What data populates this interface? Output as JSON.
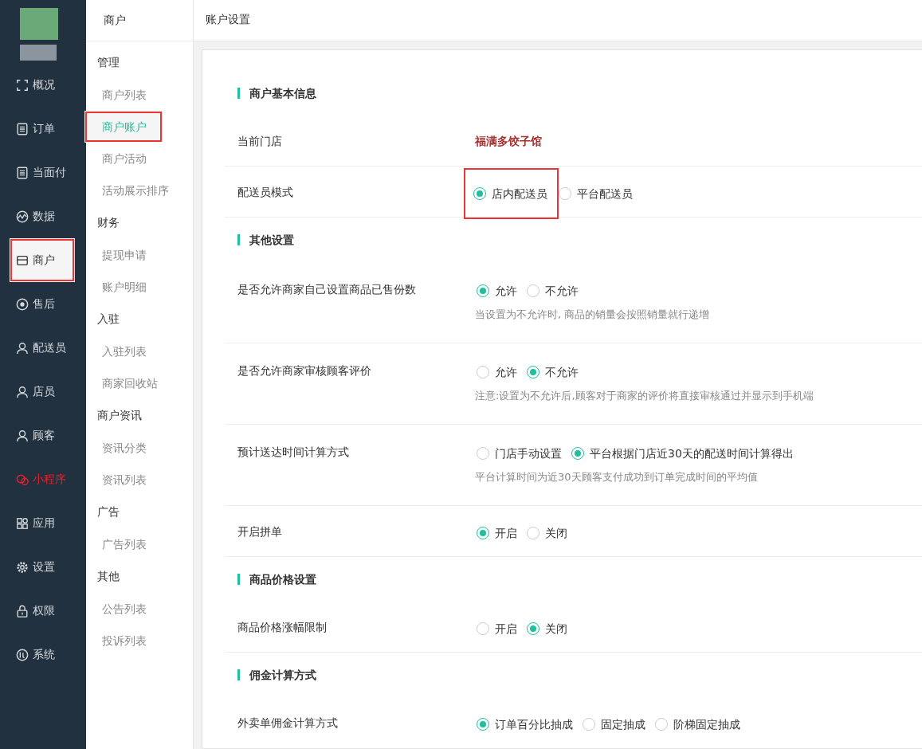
{
  "nav": [
    {
      "label": "概况",
      "selected": false,
      "alert": false,
      "marked": false
    },
    {
      "label": "订单",
      "selected": false,
      "alert": false,
      "marked": false
    },
    {
      "label": "当面付",
      "selected": false,
      "alert": false,
      "marked": false
    },
    {
      "label": "数据",
      "selected": false,
      "alert": false,
      "marked": false
    },
    {
      "label": "商户",
      "selected": true,
      "alert": false,
      "marked": true
    },
    {
      "label": "售后",
      "selected": false,
      "alert": false,
      "marked": false
    },
    {
      "label": "配送员",
      "selected": false,
      "alert": false,
      "marked": false
    },
    {
      "label": "店员",
      "selected": false,
      "alert": false,
      "marked": false
    },
    {
      "label": "顾客",
      "selected": false,
      "alert": false,
      "marked": false
    },
    {
      "label": "小程序",
      "selected": false,
      "alert": true,
      "marked": false
    },
    {
      "label": "应用",
      "selected": false,
      "alert": false,
      "marked": false
    },
    {
      "label": "设置",
      "selected": false,
      "alert": false,
      "marked": false
    },
    {
      "label": "权限",
      "selected": false,
      "alert": false,
      "marked": false
    },
    {
      "label": "系统",
      "selected": false,
      "alert": false,
      "marked": false
    }
  ],
  "subnav": {
    "title": "商户",
    "groups": [
      {
        "title": "管理",
        "items": [
          {
            "label": "商户列表",
            "selected": false,
            "marked": false
          },
          {
            "label": "商户账户",
            "selected": true,
            "marked": true
          },
          {
            "label": "商户活动",
            "selected": false,
            "marked": false
          },
          {
            "label": "活动展示排序",
            "selected": false,
            "marked": false
          }
        ]
      },
      {
        "title": "财务",
        "items": [
          {
            "label": "提现申请",
            "selected": false,
            "marked": false
          },
          {
            "label": "账户明细",
            "selected": false,
            "marked": false
          }
        ]
      },
      {
        "title": "入驻",
        "items": [
          {
            "label": "入驻列表",
            "selected": false,
            "marked": false
          },
          {
            "label": "商家回收站",
            "selected": false,
            "marked": false
          }
        ]
      },
      {
        "title": "商户资讯",
        "items": [
          {
            "label": "资讯分类",
            "selected": false,
            "marked": false
          },
          {
            "label": "资讯列表",
            "selected": false,
            "marked": false
          }
        ]
      },
      {
        "title": "广告",
        "items": [
          {
            "label": "广告列表",
            "selected": false,
            "marked": false
          }
        ]
      },
      {
        "title": "其他",
        "items": [
          {
            "label": "公告列表",
            "selected": false,
            "marked": false
          },
          {
            "label": "投诉列表",
            "selected": false,
            "marked": false
          }
        ]
      }
    ]
  },
  "page": {
    "title": "账户设置",
    "sections": [
      {
        "title": "商户基本信息",
        "rows": [
          {
            "label": "当前门店",
            "kind": "text",
            "value": "福满多饺子馆"
          },
          {
            "label": "配送员模式",
            "kind": "radio",
            "options": [
              {
                "label": "店内配送员",
                "selected": true,
                "marked": true
              },
              {
                "label": "平台配送员",
                "selected": false,
                "marked": false
              }
            ]
          }
        ]
      },
      {
        "title": "其他设置",
        "rows": [
          {
            "label": "是否允许商家自己设置商品已售份数",
            "kind": "radio",
            "options": [
              {
                "label": "允许",
                "selected": true,
                "marked": false
              },
              {
                "label": "不允许",
                "selected": false,
                "marked": false
              }
            ],
            "hint": "当设置为不允许时, 商品的销量会按照销量就行递增"
          },
          {
            "label": "是否允许商家审核顾客评价",
            "kind": "radio",
            "options": [
              {
                "label": "允许",
                "selected": false,
                "marked": false
              },
              {
                "label": "不允许",
                "selected": true,
                "marked": false
              }
            ],
            "hint": "注意:设置为不允许后,顾客对于商家的评价将直接审核通过并显示到手机端"
          },
          {
            "label": "预计送达时间计算方式",
            "kind": "radio",
            "options": [
              {
                "label": "门店手动设置",
                "selected": false,
                "marked": false
              },
              {
                "label": "平台根据门店近30天的配送时间计算得出",
                "selected": true,
                "marked": false
              }
            ],
            "hint": "平台计算时间为近30天顾客支付成功到订单完成时间的平均值"
          },
          {
            "label": "开启拼单",
            "kind": "radio",
            "options": [
              {
                "label": "开启",
                "selected": true,
                "marked": false
              },
              {
                "label": "关闭",
                "selected": false,
                "marked": false
              }
            ]
          }
        ]
      },
      {
        "title": "商品价格设置",
        "rows": [
          {
            "label": "商品价格涨幅限制",
            "kind": "radio",
            "options": [
              {
                "label": "开启",
                "selected": false,
                "marked": false
              },
              {
                "label": "关闭",
                "selected": true,
                "marked": false
              }
            ]
          }
        ]
      },
      {
        "title": "佣金计算方式",
        "rows": [
          {
            "label": "外卖单佣金计算方式",
            "kind": "radio",
            "options": [
              {
                "label": "订单百分比抽成",
                "selected": true,
                "marked": false
              },
              {
                "label": "固定抽成",
                "selected": false,
                "marked": false
              },
              {
                "label": "阶梯固定抽成",
                "selected": false,
                "marked": false
              }
            ]
          }
        ]
      }
    ]
  }
}
